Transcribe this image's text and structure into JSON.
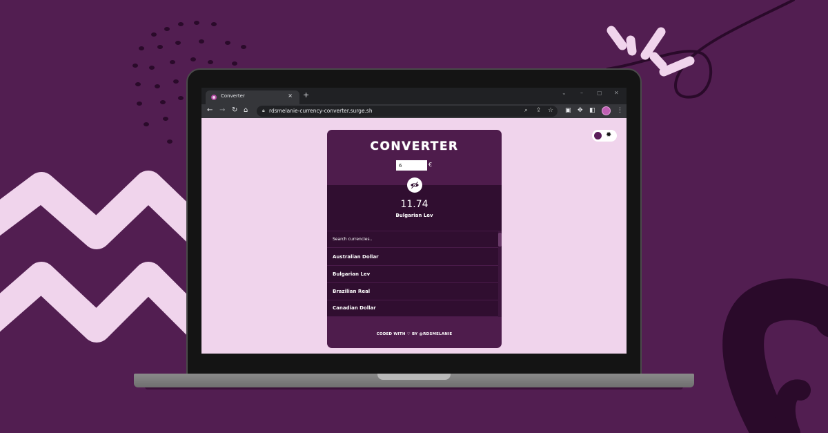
{
  "browser": {
    "tab_title": "Converter",
    "tab_close": "×",
    "new_tab": "+",
    "url": "rdsmelanie-currency-converter.surge.sh",
    "icons": [
      "back-icon",
      "forward-icon",
      "reload-icon",
      "home-icon",
      "lock-icon",
      "zoom-icon",
      "share-icon",
      "star-icon",
      "extension-icon",
      "puzzle-icon",
      "sidepanel-icon",
      "avatar",
      "menu-icon"
    ]
  },
  "app": {
    "title": "CONVERTER",
    "amount_value": "6",
    "currency_symbol": "€",
    "result_value": "11.74",
    "result_currency": "Bulgarian Lev",
    "search_placeholder": "Search currencies..",
    "currencies": [
      "Australian Dollar",
      "Bulgarian Lev",
      "Brazilian Real",
      "Canadian Dollar"
    ],
    "footer": "CODED WITH ♡ BY @RDSMELANIE"
  },
  "theme": {
    "background": "#521e51",
    "page_background": "#f0d4ec",
    "card_background": "#4e1c4c",
    "panel_background": "#300e30",
    "accent_light": "#f0d4ec"
  }
}
